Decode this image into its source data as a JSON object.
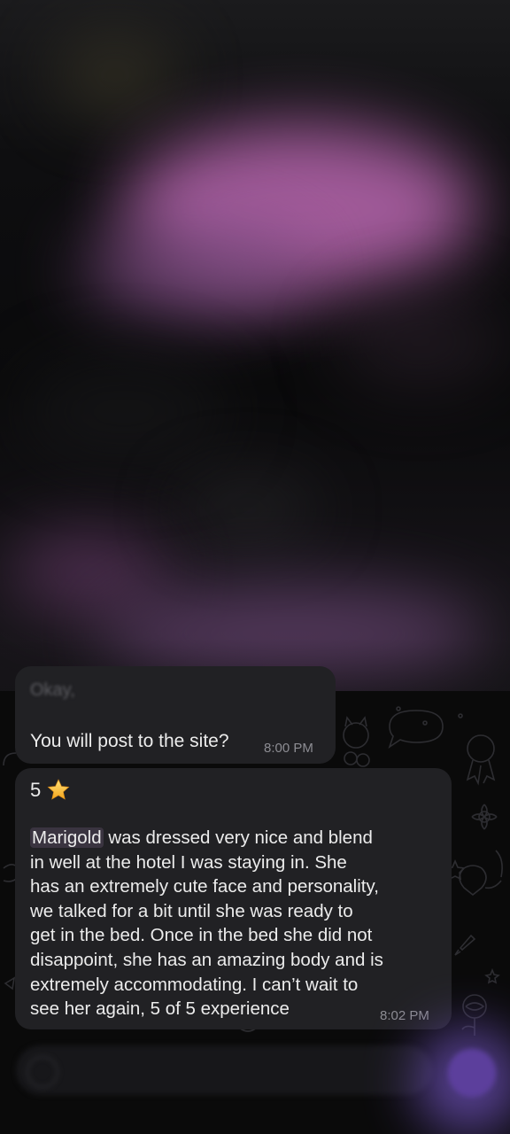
{
  "chat": {
    "messages": [
      {
        "quoted_preview": "Okay,",
        "text": "You will post to the site?",
        "time": "8:00 PM"
      },
      {
        "rating_value": "5",
        "rating_icon": "star-icon",
        "mention": "Marigold",
        "body": " was dressed very nice and blend\nin well at the hotel I was staying in. She\nhas an extremely cute face and personality,\nwe talked for a bit until she was ready to\nget in the bed.  Once in the bed she did not\ndisappoint, she has an amazing body and is\nextremely accommodating.  I can’t wait to\nsee her again, 5 of 5 experience",
        "time": "8:02 PM"
      }
    ]
  },
  "colors": {
    "bubble": "#212124",
    "background": "#0a0a0a",
    "timestamp": "#8d8d93",
    "accent": "#5c3f9c",
    "blur_highlight": "#a85ea0"
  }
}
